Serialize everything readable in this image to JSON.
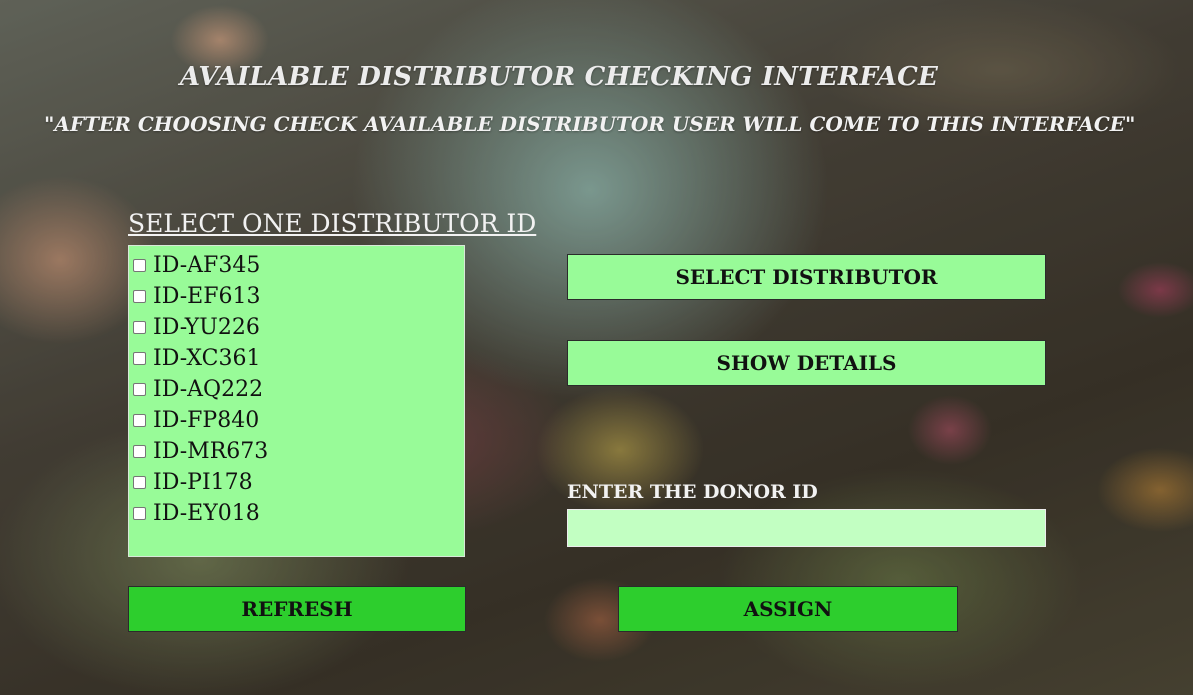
{
  "header": {
    "title": "AVAILABLE DISTRIBUTOR CHECKING INTERFACE",
    "subtitle": "\"AFTER CHOOSING CHECK AVAILABLE DISTRIBUTOR USER WILL COME TO THIS INTERFACE\""
  },
  "distributors": {
    "label": "SELECT ONE DISTRIBUTOR ID",
    "items": [
      {
        "id": "ID-AF345",
        "checked": false
      },
      {
        "id": "ID-EF613",
        "checked": false
      },
      {
        "id": "ID-YU226",
        "checked": false
      },
      {
        "id": "ID-XC361",
        "checked": false
      },
      {
        "id": "ID-AQ222",
        "checked": false
      },
      {
        "id": "ID-FP840",
        "checked": false
      },
      {
        "id": "ID-MR673",
        "checked": false
      },
      {
        "id": "ID-PI178",
        "checked": false
      },
      {
        "id": "ID-EY018",
        "checked": false
      }
    ]
  },
  "actions": {
    "select_distributor": "SELECT DISTRIBUTOR",
    "show_details": "SHOW DETAILS",
    "refresh": "REFRESH",
    "assign": "ASSIGN"
  },
  "donor": {
    "label": "ENTER THE DONOR ID",
    "value": "",
    "placeholder": ""
  },
  "colors": {
    "list_bg": "#98fb98",
    "light_button": "#98fb98",
    "dark_button": "#2dce2d",
    "input_bg": "#c2ffc2"
  }
}
